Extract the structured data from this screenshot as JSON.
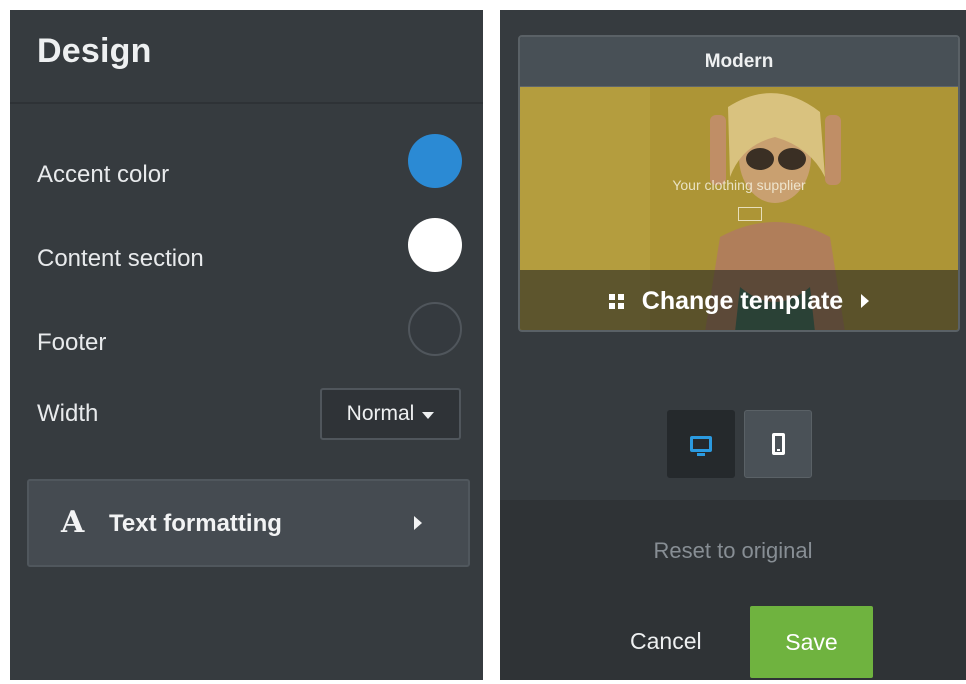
{
  "design": {
    "title": "Design",
    "accent_color_label": "Accent color",
    "content_section_label": "Content section",
    "footer_label": "Footer",
    "width_label": "Width",
    "width_value": "Normal",
    "text_formatting_icon": "A",
    "text_formatting_label": "Text formatting",
    "colors": {
      "accent": "#2b8ad4",
      "content": "#ffffff",
      "footer": "#353a3f"
    }
  },
  "template": {
    "name": "Modern",
    "preview_caption": "Your clothing supplier",
    "change_template_label": "Change template"
  },
  "devices": {
    "desktop_icon": "desktop-icon",
    "mobile_icon": "mobile-icon",
    "selected": "desktop"
  },
  "actions": {
    "reset_label": "Reset to original",
    "cancel_label": "Cancel",
    "save_label": "Save",
    "save_color": "#6fb33f"
  }
}
